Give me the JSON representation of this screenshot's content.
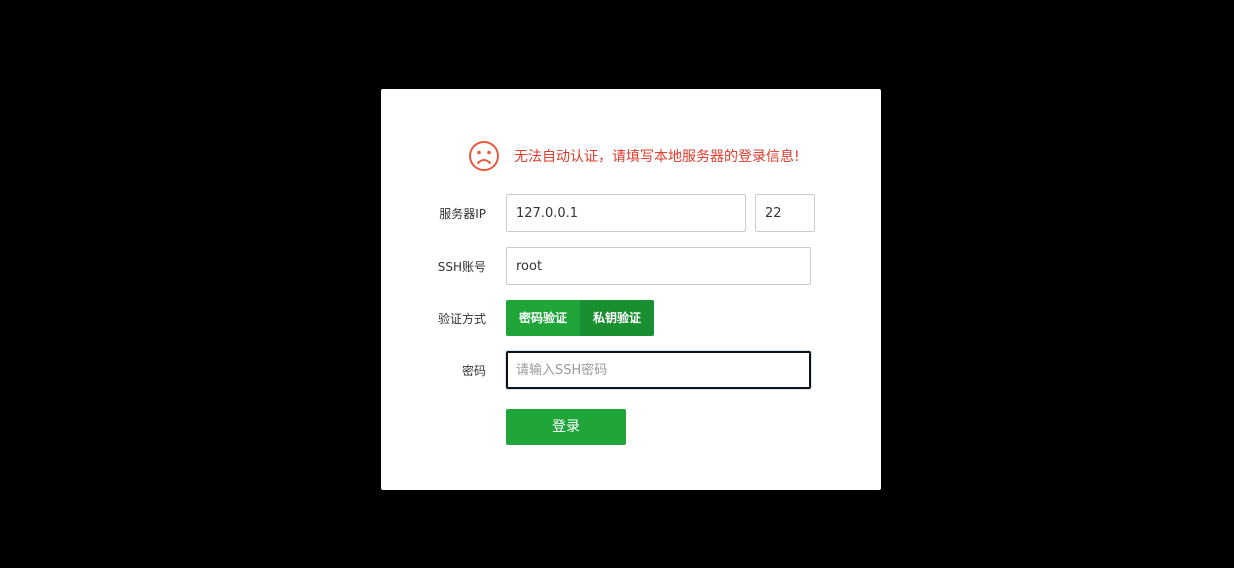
{
  "warning": {
    "message": "无法自动认证，请填写本地服务器的登录信息!",
    "icon": "sad-face-icon",
    "color": "#e03b2c"
  },
  "form": {
    "server_ip": {
      "label": "服务器IP",
      "value": "127.0.0.1",
      "port_value": "22"
    },
    "ssh_account": {
      "label": "SSH账号",
      "value": "root"
    },
    "auth_method": {
      "label": "验证方式",
      "options": [
        "密码验证",
        "私钥验证"
      ],
      "selected": "私钥验证"
    },
    "password": {
      "label": "密码",
      "placeholder": "请输入SSH密码"
    },
    "login_label": "登录"
  },
  "colors": {
    "accent": "#20a53a",
    "accent_dark": "#1a8f31"
  }
}
